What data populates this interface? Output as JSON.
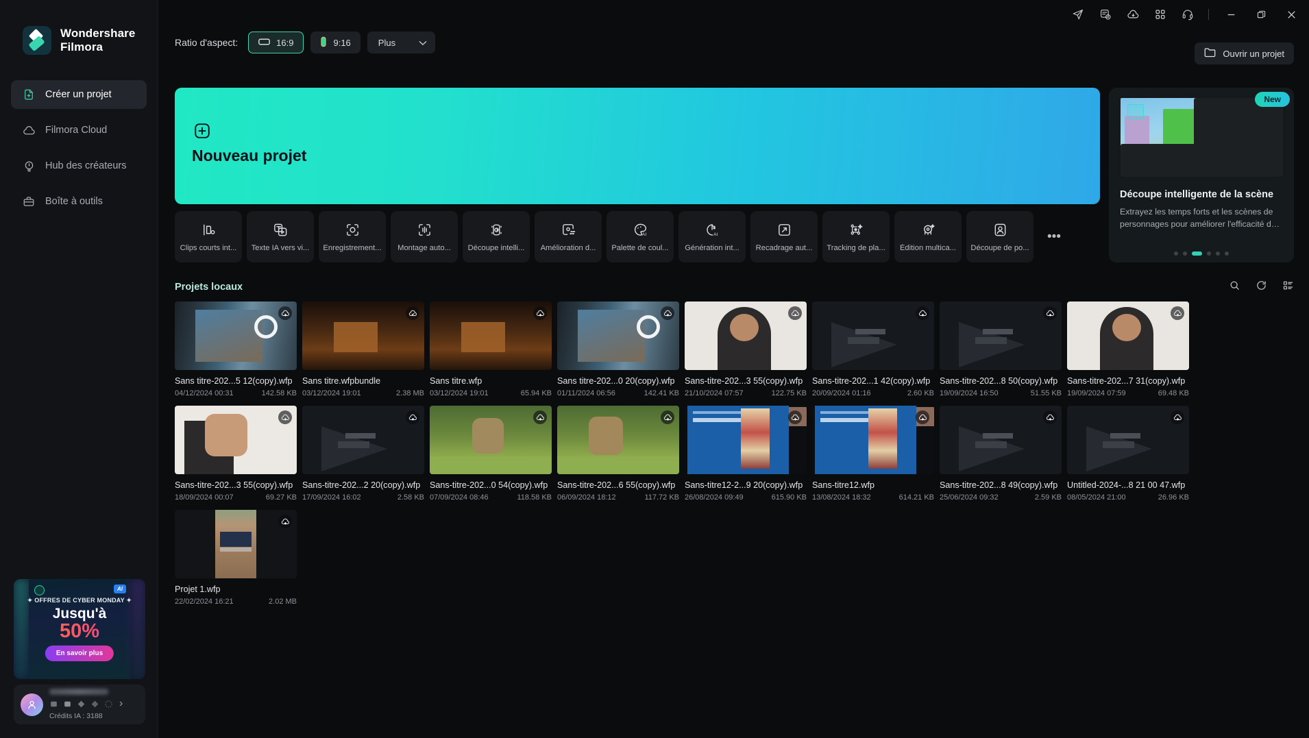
{
  "titlebar": {
    "icons": [
      {
        "name": "send-icon",
        "glyph": "send"
      },
      {
        "name": "tasks-icon",
        "glyph": "tasks"
      },
      {
        "name": "cloud-download-icon",
        "glyph": "cloud-down"
      },
      {
        "name": "apps-grid-icon",
        "glyph": "grid"
      },
      {
        "name": "support-headset-icon",
        "glyph": "headset"
      }
    ],
    "minimize_label": "—",
    "maximize_label": "❐",
    "close_label": "✕"
  },
  "sidebar": {
    "brand": {
      "line1": "Wondershare",
      "line2": "Filmora"
    },
    "items": [
      {
        "label": "Créer un projet",
        "icon": "new-project-icon",
        "active": true
      },
      {
        "label": "Filmora Cloud",
        "icon": "cloud-icon",
        "active": false
      },
      {
        "label": "Hub des créateurs",
        "icon": "creators-hub-icon",
        "active": false
      },
      {
        "label": "Boîte à outils",
        "icon": "toolbox-icon",
        "active": false
      }
    ],
    "promo": {
      "eyebrow": "✦ OFFRES DE CYBER MONDAY ✦",
      "line1": "Jusqu'à",
      "line2": "50%",
      "cta": "En savoir plus",
      "badge_right": "AI"
    },
    "user": {
      "credits": "Crédits IA : 3188",
      "chevron": "›"
    }
  },
  "toolbar": {
    "ratio_label": "Ratio d'aspect:",
    "ratios": [
      {
        "label": "16:9",
        "icon": "landscape-icon",
        "selected": true
      },
      {
        "label": "9:16",
        "icon": "portrait-icon",
        "selected": false
      }
    ],
    "more_label": "Plus",
    "more_chevron": "⌄",
    "open_project_label": "Ouvrir un projet",
    "open_project_icon": "folder-icon"
  },
  "hero": {
    "title": "Nouveau projet",
    "icon": "plus-square-icon"
  },
  "tools": [
    {
      "label": "Clips courts int...",
      "icon": "short-clips-icon"
    },
    {
      "label": "Texte IA vers vi...",
      "icon": "text-to-video-icon"
    },
    {
      "label": "Enregistrement...",
      "icon": "screen-record-icon"
    },
    {
      "label": "Montage auto...",
      "icon": "auto-montage-icon"
    },
    {
      "label": "Découpe intelli...",
      "icon": "smart-cutout-icon"
    },
    {
      "label": "Amélioration d...",
      "icon": "enhance-icon"
    },
    {
      "label": "Palette de coul...",
      "icon": "color-palette-ai-icon"
    },
    {
      "label": "Génération int...",
      "icon": "ai-music-icon"
    },
    {
      "label": "Recadrage aut...",
      "icon": "auto-reframe-icon"
    },
    {
      "label": "Tracking de pla...",
      "icon": "planar-tracking-icon"
    },
    {
      "label": "Édition multica...",
      "icon": "multicam-icon"
    },
    {
      "label": "Découpe de po...",
      "icon": "portrait-cutout-icon"
    }
  ],
  "tools_more_label": "•••",
  "promo_card": {
    "badge": "New",
    "title": "Découpe intelligente de la scène",
    "desc": "Extrayez les temps forts et les scènes de personnages pour améliorer l'efficacité du mo...",
    "dots_count": 6,
    "active_dot": 2
  },
  "section": {
    "title": "Projets locaux",
    "actions": [
      {
        "name": "search-icon"
      },
      {
        "name": "refresh-icon"
      },
      {
        "name": "list-view-icon"
      }
    ]
  },
  "projects": [
    {
      "name": "Sans titre-202...5 12(copy).wfp",
      "date": "04/12/2024 00:31",
      "size": "142.58 KB",
      "thumb": "studio",
      "cloud": "upload"
    },
    {
      "name": "Sans titre.wfpbundle",
      "date": "03/12/2024 19:01",
      "size": "2.38 MB",
      "thumb": "city",
      "cloud": "check"
    },
    {
      "name": "Sans titre.wfp",
      "date": "03/12/2024 19:01",
      "size": "65.94 KB",
      "thumb": "city",
      "cloud": "upload"
    },
    {
      "name": "Sans titre-202...0 20(copy).wfp",
      "date": "01/11/2024 06:56",
      "size": "142.41 KB",
      "thumb": "studio",
      "cloud": "upload"
    },
    {
      "name": "Sans-titre-202...3 55(copy).wfp",
      "date": "21/10/2024 07:57",
      "size": "122.75 KB",
      "thumb": "person",
      "cloud": "upload"
    },
    {
      "name": "Sans-titre-202...1 42(copy).wfp",
      "date": "20/09/2024 01:16",
      "size": "2.60 KB",
      "thumb": "placeholder",
      "cloud": "upload"
    },
    {
      "name": "Sans-titre-202...8 50(copy).wfp",
      "date": "19/09/2024 16:50",
      "size": "51.55 KB",
      "thumb": "placeholder",
      "cloud": "upload"
    },
    {
      "name": "Sans-titre-202...7 31(copy).wfp",
      "date": "19/09/2024 07:59",
      "size": "69.48 KB",
      "thumb": "person",
      "cloud": "upload"
    },
    {
      "name": "Sans-titre-202...3 55(copy).wfp",
      "date": "18/09/2024 00:07",
      "size": "69.27 KB",
      "thumb": "hand",
      "cloud": "upload"
    },
    {
      "name": "Sans-titre-202...2 20(copy).wfp",
      "date": "17/09/2024 16:02",
      "size": "2.58 KB",
      "thumb": "placeholder",
      "cloud": "upload"
    },
    {
      "name": "Sans-titre-202...0 54(copy).wfp",
      "date": "07/09/2024 08:46",
      "size": "118.58 KB",
      "thumb": "animal",
      "cloud": "upload"
    },
    {
      "name": "Sans-titre-202...6 55(copy).wfp",
      "date": "06/09/2024 18:12",
      "size": "117.72 KB",
      "thumb": "animal",
      "cloud": "upload"
    },
    {
      "name": "Sans-titre12-2...9 20(copy).wfp",
      "date": "26/08/2024 09:49",
      "size": "615.90 KB",
      "thumb": "slide",
      "cloud": "upload"
    },
    {
      "name": "Sans-titre12.wfp",
      "date": "13/08/2024 18:32",
      "size": "614.21 KB",
      "thumb": "slide",
      "cloud": "upload"
    },
    {
      "name": "Sans-titre-202...8 49(copy).wfp",
      "date": "25/06/2024 09:32",
      "size": "2.59 KB",
      "thumb": "placeholder",
      "cloud": "upload"
    },
    {
      "name": "Untitled-2024-...8 21 00 47.wfp",
      "date": "08/05/2024 21:00",
      "size": "26.96 KB",
      "thumb": "placeholder",
      "cloud": "upload"
    },
    {
      "name": "Projet 1.wfp",
      "date": "22/02/2024 16:21",
      "size": "2.02 MB",
      "thumb": "roof",
      "cloud": "upload"
    }
  ],
  "colors": {
    "accent": "#3ad6b0",
    "hero_from": "#21e8c4",
    "hero_to": "#2fa8e8",
    "bg": "#0b0c0e",
    "sidebar": "#121316",
    "section_title": "#b9e8dd"
  }
}
